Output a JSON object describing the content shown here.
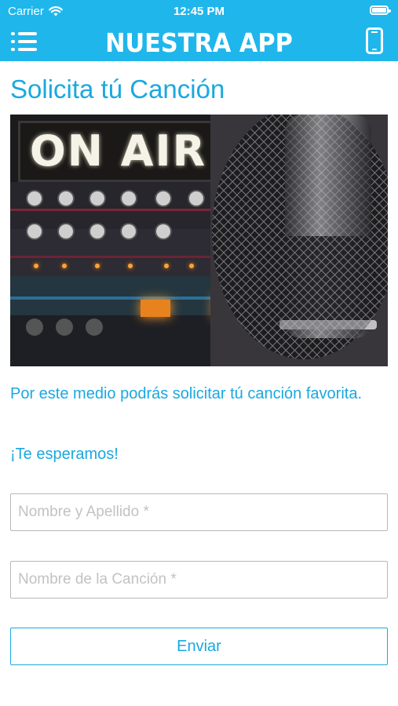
{
  "status_bar": {
    "carrier": "Carrier",
    "time": "12:45 PM"
  },
  "nav": {
    "title": "NUESTRA APP",
    "menu_icon": "menu-icon",
    "right_icon": "phone-icon"
  },
  "page": {
    "title": "Solicita tú Canción",
    "hero_sign": "ON AIR",
    "intro": "Por este medio podrás solicitar tú canción favorita.",
    "welcome": "¡Te esperamos!"
  },
  "form": {
    "name_placeholder": "Nombre y Apellido *",
    "song_placeholder": "Nombre de la Canción *",
    "submit_label": "Enviar"
  },
  "colors": {
    "accent": "#1fb6ec",
    "text": "#1aa8e0",
    "border": "#b8b8b8"
  }
}
